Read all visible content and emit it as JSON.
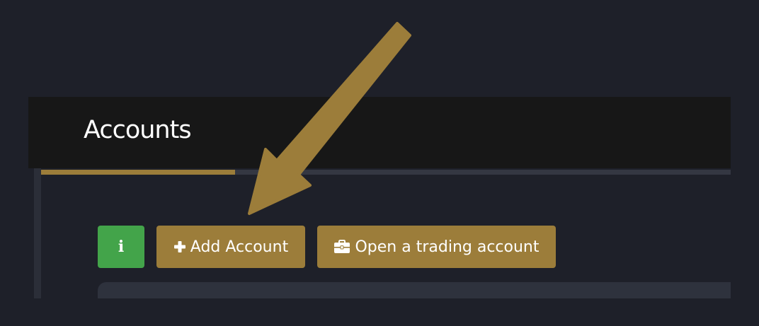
{
  "header": {
    "title": "Accounts"
  },
  "toolbar": {
    "info_label": "i",
    "add_account_label": "Add Account",
    "open_trading_label": "Open a trading account"
  },
  "icons": {
    "info": "info-icon",
    "add": "plus-icon",
    "open_trading": "briefcase-icon",
    "annotation": "arrow-annotation"
  },
  "colors": {
    "background": "#1e2029",
    "header_band": "#171717",
    "accent_gold": "#9c7d3a",
    "info_green": "#43a44a",
    "panel": "#2e323d"
  }
}
